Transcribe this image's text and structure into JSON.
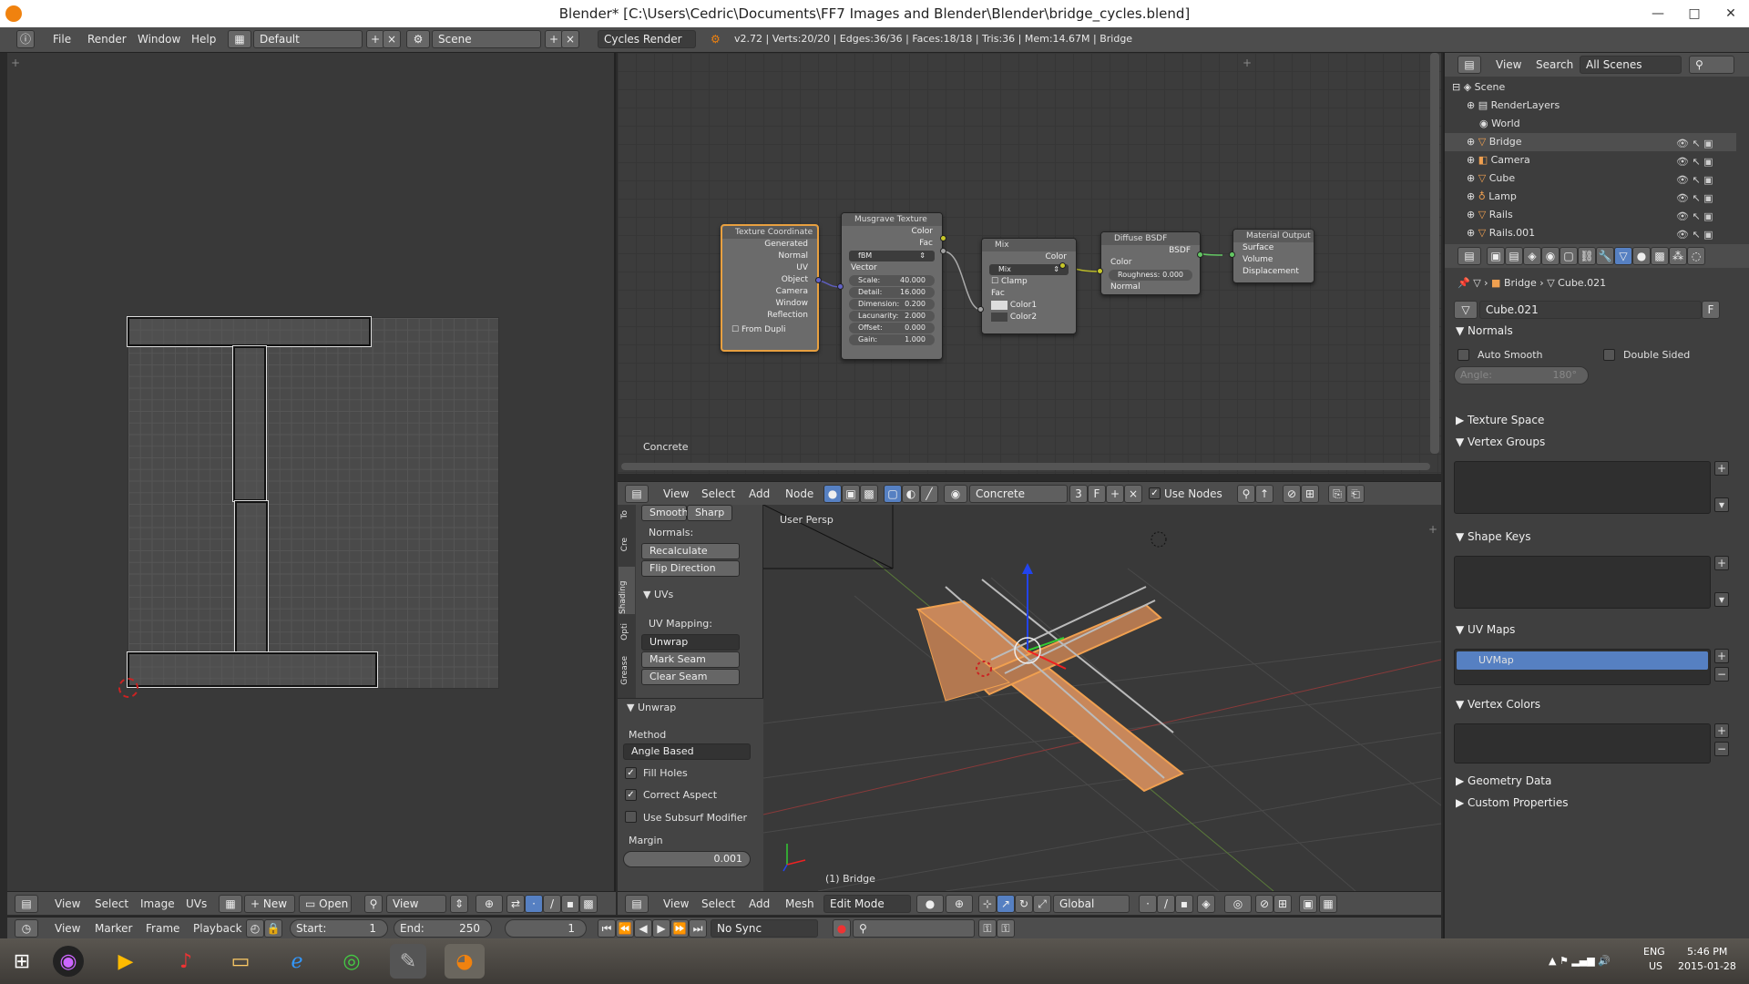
{
  "window": {
    "title": "Blender* [C:\\Users\\Cedric\\Documents\\FF7 Images and Blender\\Blender\\bridge_cycles.blend]"
  },
  "topbar": {
    "menus": [
      "File",
      "Render",
      "Window",
      "Help"
    ],
    "layout": "Default",
    "scene": "Scene",
    "engine": "Cycles Render",
    "stats": "v2.72 | Verts:20/20 | Edges:36/36 | Faces:18/18 | Tris:36 | Mem:14.67M | Bridge"
  },
  "nodes": {
    "texcoord": {
      "title": "Texture Coordinate",
      "outputs": [
        "Generated",
        "Normal",
        "UV",
        "Object",
        "Camera",
        "Window",
        "Reflection"
      ],
      "from_dupli": "From Dupli"
    },
    "musgrave": {
      "title": "Musgrave Texture",
      "out_color": "Color",
      "out_fac": "Fac",
      "type": "fBM",
      "vector": "Vector",
      "params": [
        {
          "k": "Scale:",
          "v": "40.000"
        },
        {
          "k": "Detail:",
          "v": "16.000"
        },
        {
          "k": "Dimension:",
          "v": "0.200"
        },
        {
          "k": "Lacunarity:",
          "v": "2.000"
        },
        {
          "k": "Offset:",
          "v": "0.000"
        },
        {
          "k": "Gain:",
          "v": "1.000"
        }
      ]
    },
    "mix": {
      "title": "Mix",
      "out": "Color",
      "mode": "Mix",
      "clamp": "Clamp",
      "fac": "Fac",
      "color1": "Color1",
      "color2": "Color2"
    },
    "diffuse": {
      "title": "Diffuse BSDF",
      "out": "BSDF",
      "color": "Color",
      "roughness": "Roughness:",
      "roughness_val": "0.000",
      "normal": "Normal"
    },
    "output": {
      "title": "Material Output",
      "surface": "Surface",
      "volume": "Volume",
      "displacement": "Displacement"
    },
    "material_label": "Concrete"
  },
  "node_header": {
    "menus": [
      "View",
      "Select",
      "Add",
      "Node"
    ],
    "material": "Concrete",
    "users": "3",
    "fake": "F",
    "use_nodes": "Use Nodes"
  },
  "tool_shelf": {
    "tabs": [
      "To",
      "Cre",
      "Shading",
      "Opti",
      "Grease"
    ],
    "smooth": "Smooth",
    "sharp": "Sharp",
    "normals": "Normals:",
    "recalculate": "Recalculate",
    "flip": "Flip Direction",
    "uvs_title": "UVs",
    "uv_mapping": "UV Mapping:",
    "unwrap_btn": "Unwrap",
    "mark_seam": "Mark Seam",
    "clear_seam": "Clear Seam",
    "unwrap_title": "Unwrap",
    "method": "Method",
    "method_val": "Angle Based",
    "fill_holes": "Fill Holes",
    "correct_aspect": "Correct Aspect",
    "subsurf": "Use Subsurf Modifier",
    "margin": "Margin",
    "margin_val": "0.001"
  },
  "viewport": {
    "label": "User Persp",
    "object": "(1) Bridge"
  },
  "vp_header": {
    "menus": [
      "View",
      "Select",
      "Add",
      "Mesh"
    ],
    "mode": "Edit Mode",
    "orientation": "Global"
  },
  "uv_header": {
    "menus": [
      "View",
      "Select",
      "Image",
      "UVs"
    ],
    "new": "New",
    "open": "Open",
    "view": "View"
  },
  "timeline": {
    "menus": [
      "View",
      "Marker",
      "Frame",
      "Playback"
    ],
    "start": "Start:",
    "start_val": "1",
    "end": "End:",
    "end_val": "250",
    "current": "1",
    "sync": "No Sync"
  },
  "outliner": {
    "menus": [
      "View",
      "Search"
    ],
    "filter": "All Scenes",
    "items": [
      {
        "name": "Scene",
        "indent": 0
      },
      {
        "name": "RenderLayers",
        "indent": 1
      },
      {
        "name": "World",
        "indent": 1
      },
      {
        "name": "Bridge",
        "indent": 1
      },
      {
        "name": "Camera",
        "indent": 1
      },
      {
        "name": "Cube",
        "indent": 1
      },
      {
        "name": "Lamp",
        "indent": 1
      },
      {
        "name": "Rails",
        "indent": 1
      },
      {
        "name": "Rails.001",
        "indent": 1
      }
    ]
  },
  "properties": {
    "breadcrumb_obj": "Bridge",
    "breadcrumb_mesh": "Cube.021",
    "mesh_name": "Cube.021",
    "fake": "F",
    "normals": "Normals",
    "auto_smooth": "Auto Smooth",
    "double_sided": "Double Sided",
    "angle": "Angle:",
    "angle_val": "180°",
    "texture_space": "Texture Space",
    "vertex_groups": "Vertex Groups",
    "shape_keys": "Shape Keys",
    "uv_maps": "UV Maps",
    "uv_map_name": "UVMap",
    "vertex_colors": "Vertex Colors",
    "geometry_data": "Geometry Data",
    "custom_props": "Custom Properties"
  },
  "taskbar": {
    "lang": "ENG",
    "region": "US",
    "time": "5:46 PM",
    "date": "2015-01-28"
  }
}
